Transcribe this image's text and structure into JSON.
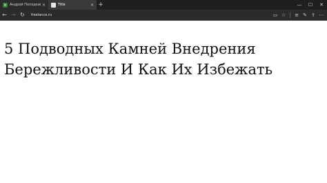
{
  "tabs": [
    {
      "favicon": "M",
      "label": "Андрей Поподкин — Бирж"
    },
    {
      "favicon": "",
      "label": "Title"
    }
  ],
  "window": {
    "minimize_icon": "minimize-icon",
    "maximize_icon": "maximize-icon",
    "close_icon": "close-icon"
  },
  "address": {
    "url": "freelance.ru"
  },
  "page": {
    "heading": "5 Подводных Камней Внедрения Бережливости И Как Их Избежать"
  }
}
